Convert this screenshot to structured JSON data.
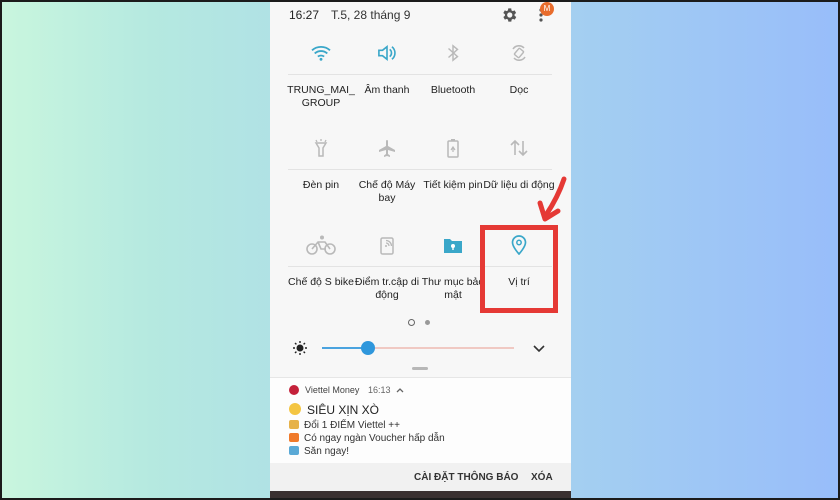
{
  "status_bar": {
    "time": "16:27",
    "date": "T.5, 28 tháng 9",
    "avatar_initial": "M"
  },
  "tiles": [
    {
      "label": "TRUNG_MAI_ GROUP",
      "icon": "wifi-icon",
      "active": true
    },
    {
      "label": "Âm thanh",
      "icon": "sound-icon",
      "active": true
    },
    {
      "label": "Bluetooth",
      "icon": "bluetooth-icon",
      "active": false
    },
    {
      "label": "Dọc",
      "icon": "rotation-icon",
      "active": false
    },
    {
      "label": "Đèn pin",
      "icon": "flashlight-icon",
      "active": false
    },
    {
      "label": "Chế độ Máy bay",
      "icon": "airplane-icon",
      "active": false
    },
    {
      "label": "Tiết kiệm pin",
      "icon": "battery-saver-icon",
      "active": false
    },
    {
      "label": "Dữ liệu di động",
      "icon": "mobile-data-icon",
      "active": false
    },
    {
      "label": "Chế độ S bike",
      "icon": "bike-icon",
      "active": false
    },
    {
      "label": "Điểm tr.cập di động",
      "icon": "hotspot-icon",
      "active": false
    },
    {
      "label": "Thư mục bảo mật",
      "icon": "secure-folder-icon",
      "active": true
    },
    {
      "label": "Vị trí",
      "icon": "location-icon",
      "active": true
    }
  ],
  "brightness": {
    "level": 0.24
  },
  "notification": {
    "app_name": "Viettel Money",
    "time": "16:13",
    "title": "SIÊU XỊN XÒ",
    "lines": [
      "Đổi 1 ĐIỂM Viettel ++",
      "Có ngay ngàn Voucher hấp dẫn",
      "Săn ngay!"
    ],
    "actions": {
      "settings": "CÀI ĐẶT THÔNG BÁO",
      "clear": "XÓA"
    }
  },
  "colors": {
    "accent": "#3aa7c9",
    "inactive": "#b9b9b9",
    "highlight": "#e53935"
  }
}
